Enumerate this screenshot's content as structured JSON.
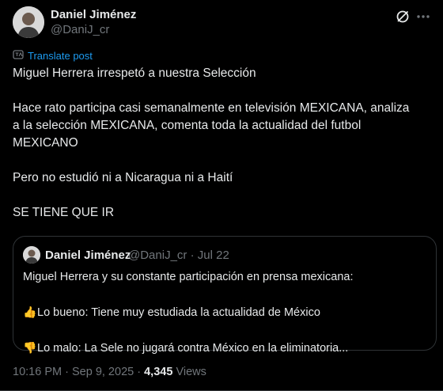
{
  "author": {
    "name": "Daniel Jiménez",
    "handle": "@DaniJ_cr"
  },
  "header_icons": {
    "grok": "grok-slash-icon",
    "more": "more-dots-icon"
  },
  "translate": {
    "label": "Translate post",
    "icon": "translate-icon"
  },
  "post": {
    "line1": "Miguel Herrera irrespetó a nuestra Selección",
    "line2": "Hace rato participa casi semanalmente en televisión MEXICANA, analiza",
    "line3": "a la selección MEXICANA, comenta toda la actualidad del futbol",
    "line4": "MEXICANO",
    "line5": "Pero no estudió ni a Nicaragua ni a Haití",
    "line6": "SE TIENE QUE IR"
  },
  "quote": {
    "name": "Daniel Jiménez",
    "handle": "@DaniJ_cr",
    "separator": "·",
    "date": "Jul 22",
    "text1": "Miguel Herrera y su constante participación en prensa mexicana:",
    "good_emoji": "👍",
    "text2": "Lo bueno: Tiene muy estudiada la actualidad de México",
    "bad_emoji": "👎",
    "text3": "Lo malo: La Sele no jugará contra México en la eliminatoria..."
  },
  "meta": {
    "time": "10:16 PM",
    "separator": "·",
    "date": "Sep 9, 2025",
    "views_count": "4,345",
    "views_label": "Views"
  },
  "colors": {
    "background": "#000000",
    "text": "#e7e9ea",
    "secondary": "#71767b",
    "link": "#1d9bf0",
    "border": "#2f3336"
  }
}
